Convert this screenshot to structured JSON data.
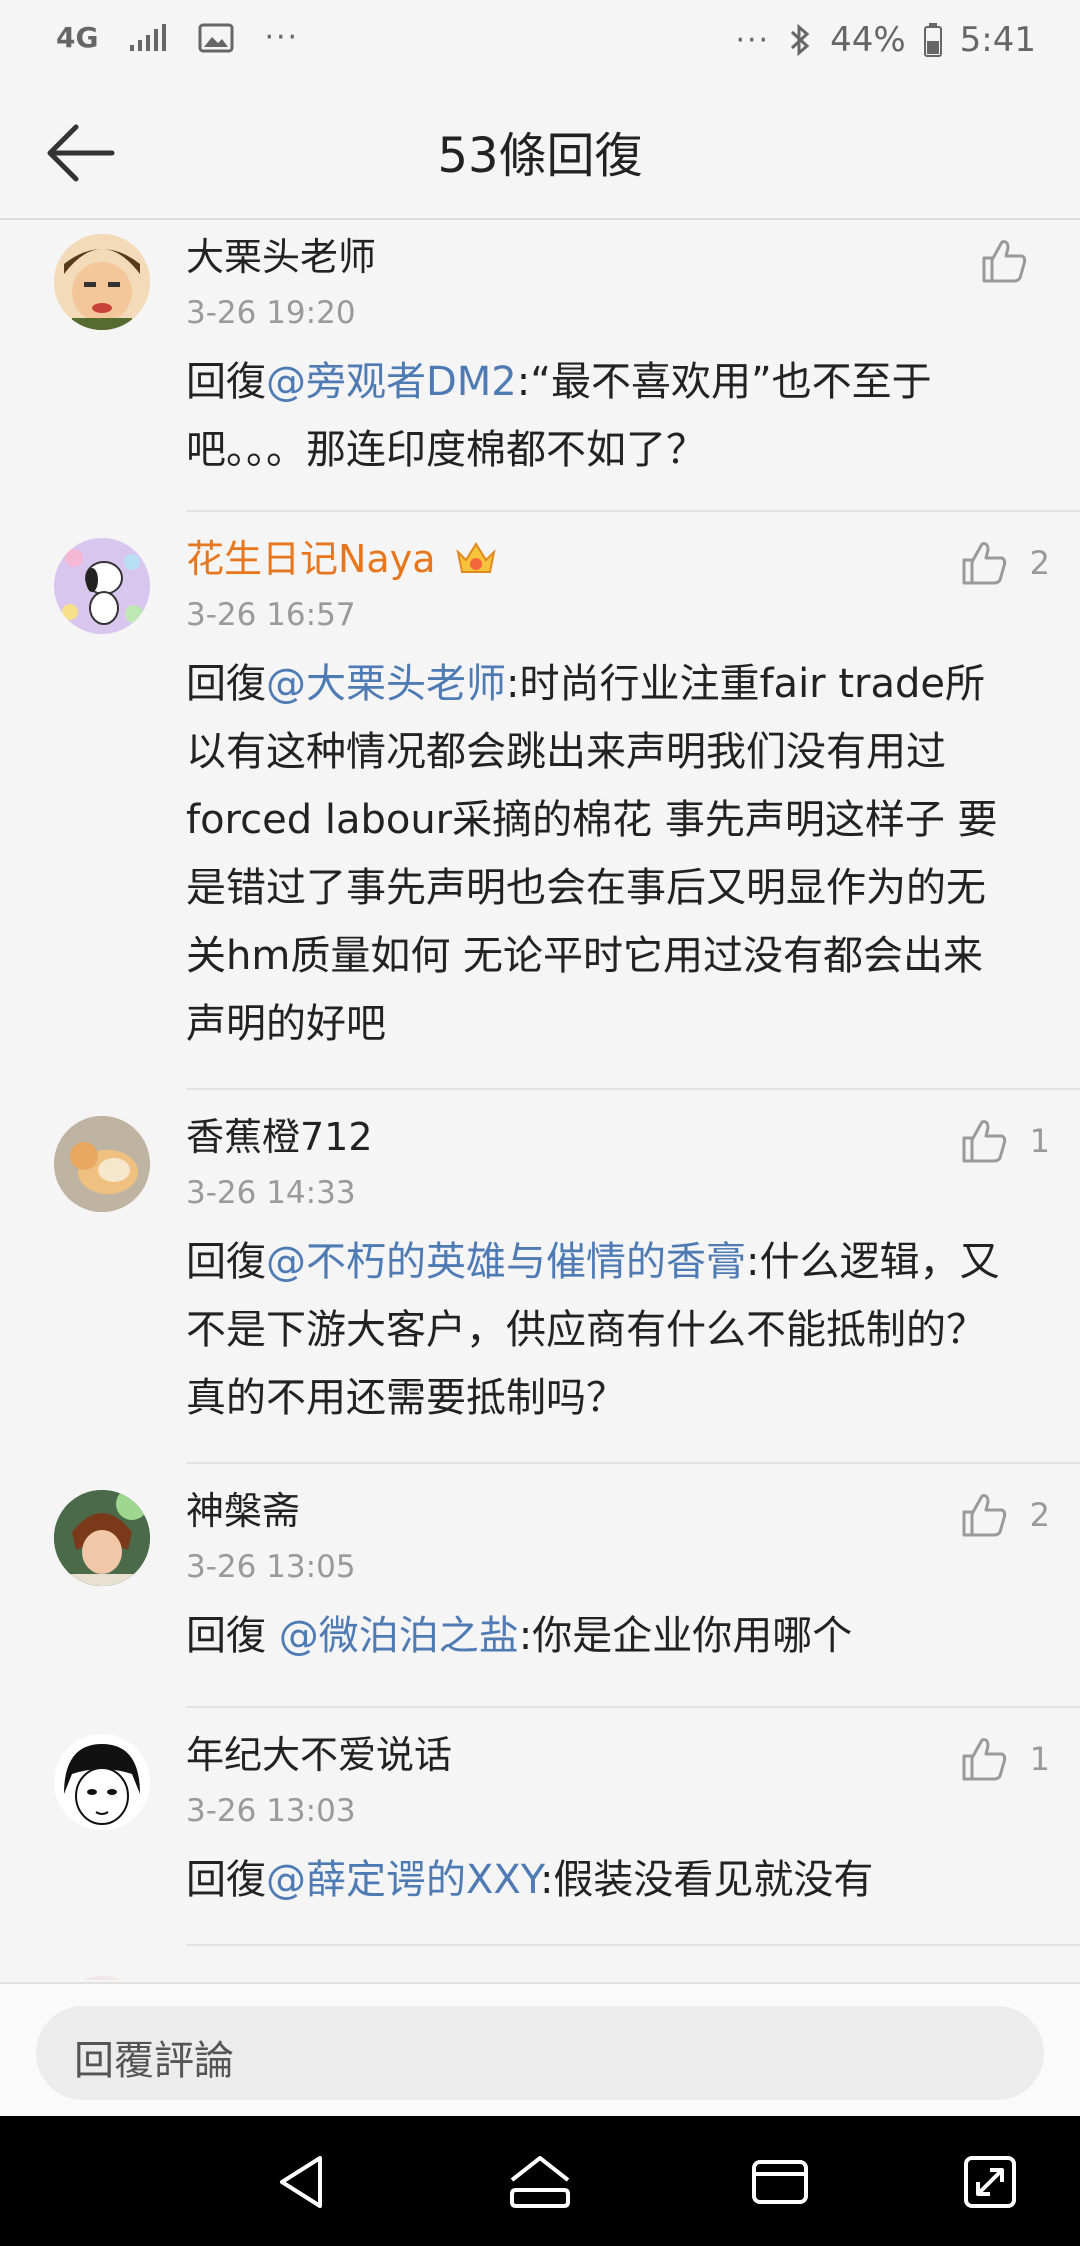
{
  "status_bar": {
    "network": "4G",
    "dots_left": "···",
    "dots_right": "···",
    "battery": "44%",
    "time": "5:41"
  },
  "header": {
    "title": "53條回復"
  },
  "comments": [
    {
      "name": "大栗头老师",
      "time": "3-26 19:20",
      "prefix": "回復",
      "mention": "@旁观者DM2",
      "body": ":“最不喜欢用”也不至于吧。。。那连印度棉都不如了？",
      "likes": ""
    },
    {
      "name": "花生日记Naya",
      "time": "3-26 16:57",
      "prefix": "回復",
      "mention": "@大栗头老师",
      "body": ":时尚行业注重fair trade所以有这种情况都会跳出来声明我们没有用过forced labour采摘的棉花 事先声明这样子 要是错过了事先声明也会在事后又明显作为的无关hm质量如何 无论平时它用过没有都会出来声明的好吧",
      "likes": "2"
    },
    {
      "name": "香蕉橙712",
      "time": "3-26 14:33",
      "prefix": "回復",
      "mention": "@不朽的英雄与催情的香膏",
      "body": ":什么逻辑，又不是下游大客户，供应商有什么不能抵制的？真的不用还需要抵制吗？",
      "likes": "1"
    },
    {
      "name": "神槃斋",
      "time": "3-26 13:05",
      "prefix": "回復 ",
      "mention": "@微泊泊之盐",
      "body": ":你是企业你用哪个",
      "likes": "2"
    },
    {
      "name": "年纪大不爱说话",
      "time": "3-26 13:03",
      "prefix": "回復",
      "mention": "@薛定谔的XXY",
      "body": ":假装没看见就没有",
      "likes": "1"
    }
  ],
  "footer": {
    "reply_placeholder": "回覆評論"
  },
  "colors": {
    "mention": "#4f7bb5",
    "vip_name": "#e8761c",
    "background": "#f5f5f5"
  }
}
